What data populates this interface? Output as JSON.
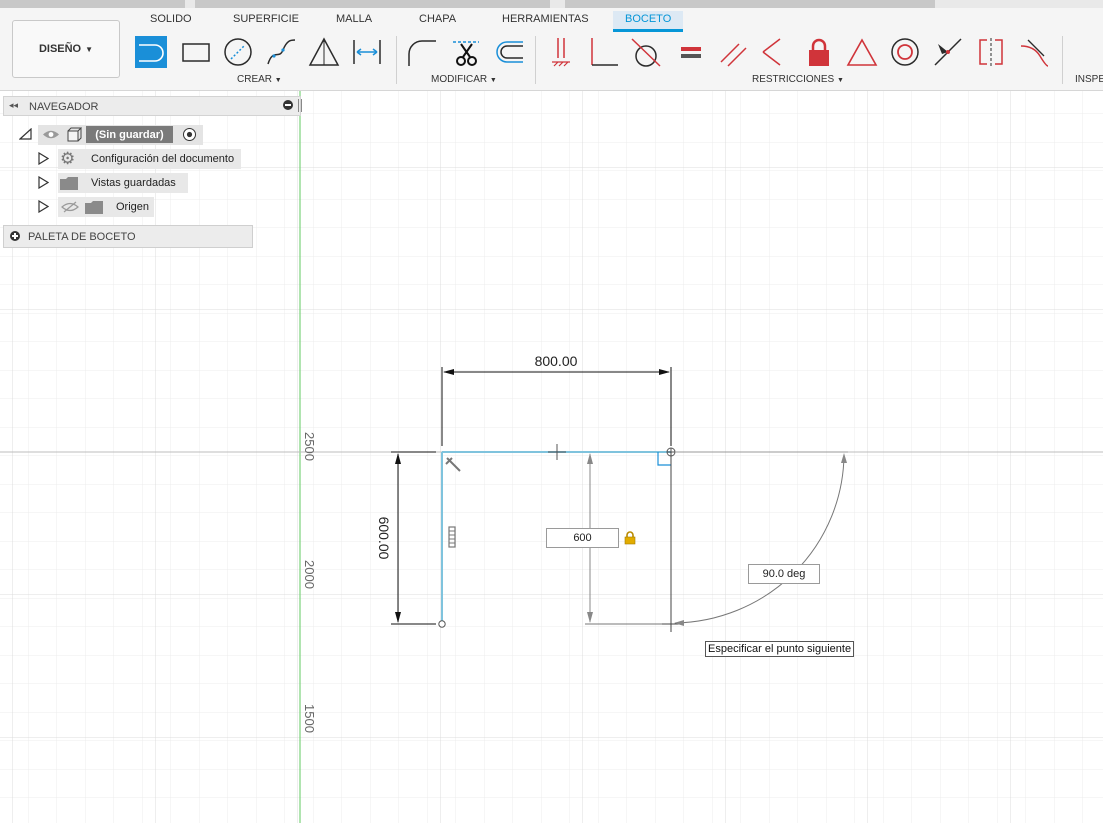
{
  "tabs": [
    "SOLIDO",
    "SUPERFICIE",
    "MALLA",
    "CHAPA",
    "HERRAMIENTAS",
    "BOCETO"
  ],
  "active_tab": "BOCETO",
  "workspace_button": "DISEÑO",
  "groups": {
    "crear": "CREAR",
    "modificar": "MODIFICAR",
    "restricciones": "RESTRICCIONES",
    "inspeccionar": "INSPE"
  },
  "browser": {
    "title": "NAVEGADOR",
    "root": "(Sin guardar)",
    "items": [
      "Configuración del documento",
      "Vistas guardadas",
      "Origen"
    ]
  },
  "palette": {
    "title": "PALETA DE BOCETO"
  },
  "canvas": {
    "ruler_labels": [
      "2500",
      "2000",
      "1500"
    ],
    "dim_horizontal": "800.00",
    "dim_vertical": "600.00",
    "length_input": "600",
    "angle_input": "90.0 deg",
    "tooltip": "Especificar el punto siguiente"
  },
  "colors": {
    "accent": "#0696d7",
    "sketch_line": "#7fc3dd",
    "constraint_red": "#d0343a",
    "grid": "#e6e6e6",
    "axis_green": "#7cd27c"
  }
}
